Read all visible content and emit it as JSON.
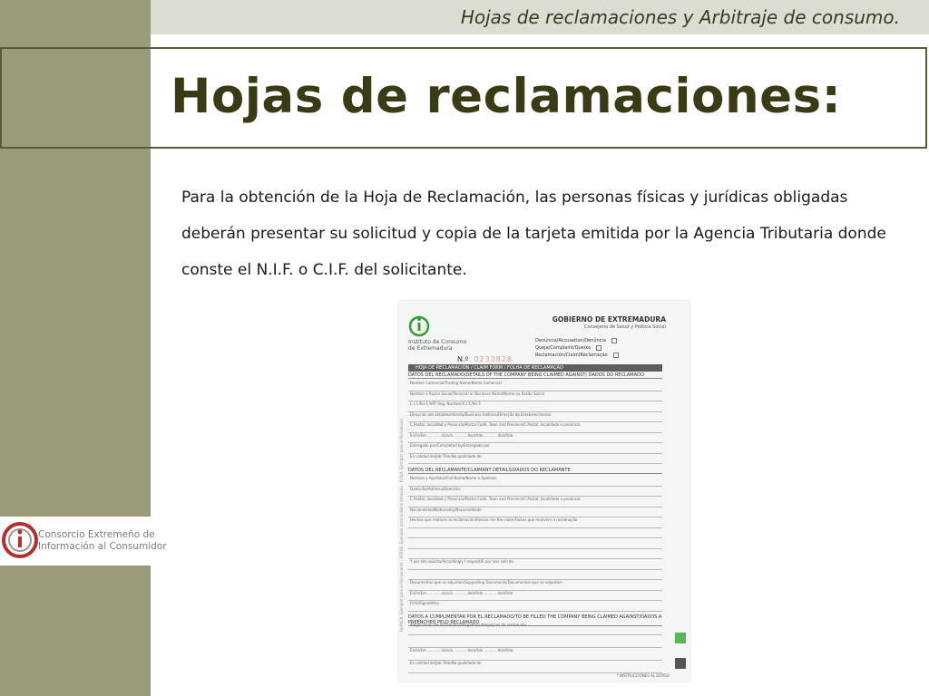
{
  "header": {
    "subtitle": "Hojas de reclamaciones y Arbitraje de consumo."
  },
  "title": "Hojas de reclamaciones:",
  "body": {
    "paragraph": "Para la obtención de la Hoja de Reclamación, las personas físicas y jurídicas obligadas deberán presentar su solicitud y copia de la tarjeta emitida por la Agencia Tributaria donde conste el N.I.F. o C.I.F. del solicitante."
  },
  "logo": {
    "line1": "Consorcio Extremeño de",
    "line2": "Información al Consumidor"
  },
  "form": {
    "institute": "Instituto de Consumo\nde Extremadura",
    "government": "GOBIERNO DE EXTREMADURA",
    "ministry": "Consejería de Salud y Política Social",
    "options": [
      "Denuncia/Accusation/Denúncia",
      "Queja/Complaint/Queixa",
      "Reclamación/Claim/Reclamação"
    ],
    "number_label": "N.º",
    "number": "0233828",
    "band": "HOJA DE RECLAMACIÓN   /   CLAIM FORM   /   FOLHA DE RECLAMAÇÃO",
    "section1": "DATOS DEL RECLAMADO/DETAILS OF THE COMPANY BEING CLAIMED AGAINST/ DADOS DO RECLAMADO",
    "section2": "DATOS DEL RECLAMANTE/CLAIMANT DETAILS/DADOS DO RECLAMANTE",
    "section3": "DATOS A CUMPLIMENTAR POR EL RECLAMADO/TO BE FILLED THE COMPANY BEING CLAIMED AGAINST/DADOS A PREENCHER PELO RECLAMADO",
    "rows1": [
      "Nombre Comercial/Trading Name/Nome Comercial",
      "Nombre o Razón Social/Personal or Business Name/Nome ou Razão Social",
      "C.I.F./N.I.F./VAT Reg. Number/C.I.F./N.I.F.",
      "Dirección del Establecimiento/Business Address/Direcção do Estabelecimento",
      "C.Postal, localidad y Provincia/Postal Code, Town and Province/C.Postal, localidade e provincia",
      "En/In/Em ........... a/on/a ........... de/of/de ........... de/of/de",
      "Entregado por/Completed by/Entregado por",
      "En calidad de/Job Title/Na qualidade de"
    ],
    "rows2": [
      "Nombre y Apellidos/Full Name/Nome e Apelidos",
      "Domicilio/Address/Domicílio",
      "C.Postal, localidad y Provincia/Postal Code, Town and Province/C.Postal, localidade e provincia",
      "Nacionalidad/Nationality/Nacionalidade",
      "Hechos que motiven la reclamación/Reason for the claim/Factos que motivem a reclamação",
      "",
      "",
      "",
      "Y por ello solicito/Accordingly I request/E por isso solicito",
      "",
      "Documentos que se adjuntan/Supporting Documents/Documentos que se adjuntam",
      "En/In/Em ........... a/on/a ........... de/of/de ........... de/of/de",
      "Firfa/Signed/Ass"
    ],
    "rows3": [
      "Alegaciones del reclamado/Allegations/Alegações do reclamado",
      "",
      "En/In/Em ........... a/on/a ........... de/of/de ........... de/of/de",
      "En calidad de/Job Title/Na qualidade de"
    ],
    "side_text": "BLANCA: Ejemplar para el Reclamante · VERDE: Ejemplar para la Administración · ROSA: Ejemplar para el Reclamado",
    "footer": "* INSTRUCCIONES AL DORSO"
  }
}
